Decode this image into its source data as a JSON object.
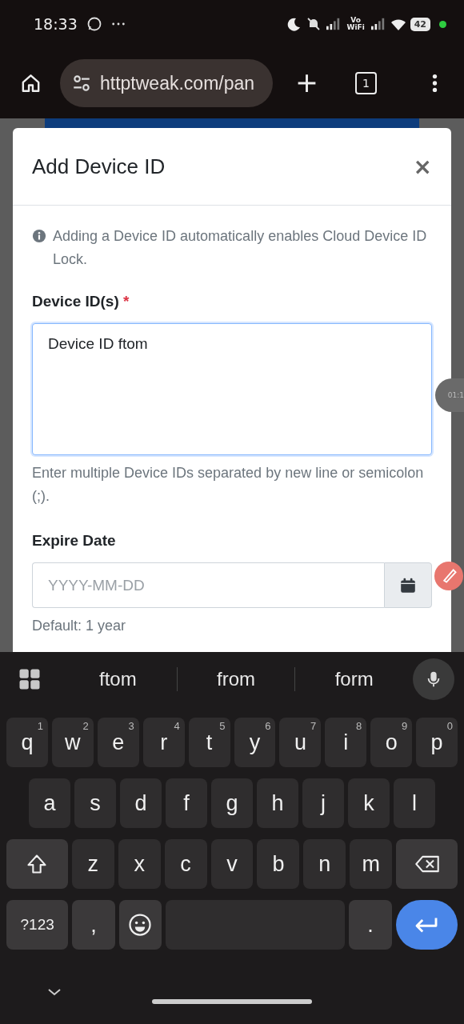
{
  "status_bar": {
    "time": "18:33",
    "vowifi": "Vo WiFi",
    "battery": "42"
  },
  "browser": {
    "url": "httptweak.com/pan",
    "tab_count": "1"
  },
  "modal": {
    "title": "Add Device ID",
    "close": "×",
    "info": "Adding a Device ID automatically enables Cloud Device ID Lock.",
    "device_ids": {
      "label": "Device ID(s)",
      "required": "*",
      "value": "Device ID ftom",
      "focused": true,
      "hint": "Enter multiple Device IDs separated by new line or semicolon (;)."
    },
    "expire_date": {
      "label": "Expire Date",
      "placeholder": "YYYY-MM-DD",
      "hint": "Default: 1 year"
    }
  },
  "recorder_bubble": {
    "timer": "01:1"
  },
  "keyboard": {
    "suggestions": [
      "ftom",
      "from",
      "form"
    ],
    "rows": [
      {
        "keys": [
          {
            "label": "q",
            "hint": "1"
          },
          {
            "label": "w",
            "hint": "2"
          },
          {
            "label": "e",
            "hint": "3"
          },
          {
            "label": "r",
            "hint": "4"
          },
          {
            "label": "t",
            "hint": "5"
          },
          {
            "label": "y",
            "hint": "6"
          },
          {
            "label": "u",
            "hint": "7"
          },
          {
            "label": "i",
            "hint": "8"
          },
          {
            "label": "o",
            "hint": "9"
          },
          {
            "label": "p",
            "hint": "0"
          }
        ]
      },
      {
        "keys": [
          {
            "label": "a"
          },
          {
            "label": "s"
          },
          {
            "label": "d"
          },
          {
            "label": "f"
          },
          {
            "label": "g"
          },
          {
            "label": "h"
          },
          {
            "label": "j"
          },
          {
            "label": "k"
          },
          {
            "label": "l"
          }
        ]
      },
      {
        "keys": [
          {
            "kind": "shift"
          },
          {
            "label": "z"
          },
          {
            "label": "x"
          },
          {
            "label": "c"
          },
          {
            "label": "v"
          },
          {
            "label": "b"
          },
          {
            "label": "n"
          },
          {
            "label": "m"
          },
          {
            "kind": "backspace"
          }
        ]
      },
      {
        "keys": [
          {
            "kind": "symbols",
            "label": "?123"
          },
          {
            "label": ","
          },
          {
            "kind": "emoji"
          },
          {
            "kind": "space"
          },
          {
            "label": "."
          },
          {
            "kind": "enter"
          }
        ]
      }
    ]
  }
}
